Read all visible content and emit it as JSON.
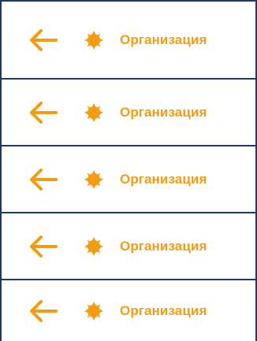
{
  "colors": {
    "accent": "#f39c12",
    "border": "#1c3a6b",
    "background": "#ffffff"
  },
  "icons": {
    "back": "arrow-left-icon",
    "item": "sun-badge-icon"
  },
  "rows": [
    {
      "label": "Организация"
    },
    {
      "label": "Организация"
    },
    {
      "label": "Организация"
    },
    {
      "label": "Организация"
    },
    {
      "label": "Организация"
    }
  ]
}
